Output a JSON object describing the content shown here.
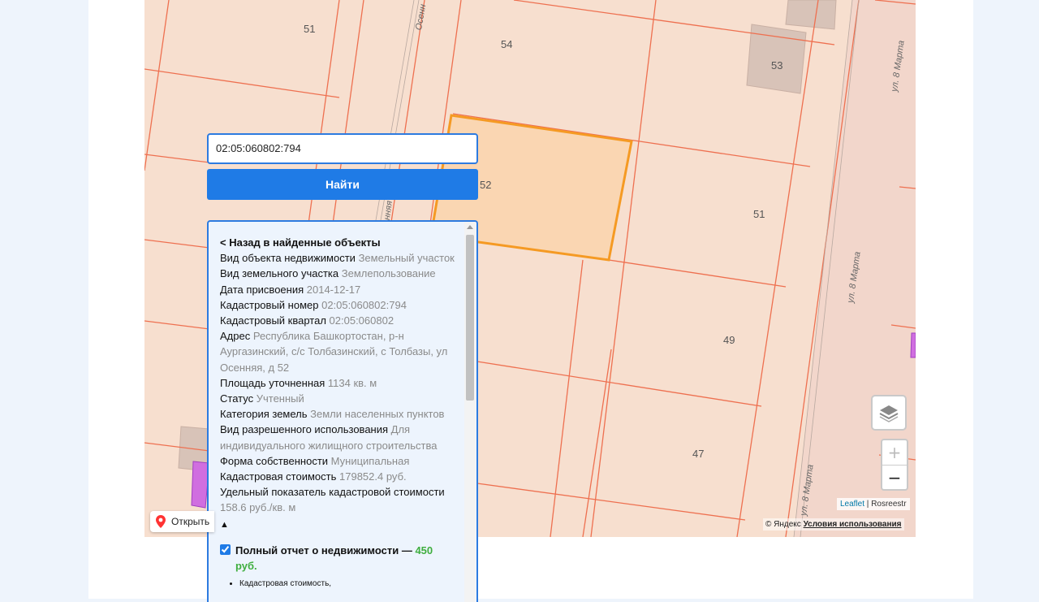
{
  "search": {
    "value": "02:05:060802:794"
  },
  "find_button": {
    "label": "Найти"
  },
  "map": {
    "plot_numbers": [
      "51",
      "54",
      "53",
      "52",
      "51",
      "49",
      "47"
    ],
    "streets": [
      "Осенн",
      "ул. 8 Марта",
      "ул. 8 Марта",
      "ул. 8 Марта",
      "енняя"
    ],
    "highlight_color": "#f59a23",
    "parcel_line_color": "#f07050"
  },
  "info": {
    "back_link": "< Назад в найденные объекты",
    "fields": [
      {
        "key": "Вид объекта недвижимости",
        "value": "Земельный участок"
      },
      {
        "key": "Вид земельного участка",
        "value": "Землепользование"
      },
      {
        "key": "Дата присвоения",
        "value": "2014-12-17"
      },
      {
        "key": "Кадастровый номер",
        "value": "02:05:060802:794"
      },
      {
        "key": "Кадастровый квартал",
        "value": "02:05:060802"
      },
      {
        "key": "Адрес",
        "value": "Республика Башкортостан, р-н Аургазинский, с/с Толбазинский, с Толбазы, ул Осенняя, д 52"
      },
      {
        "key": "Площадь уточненная",
        "value": "1134 кв. м"
      },
      {
        "key": "Статус",
        "value": "Учтенный"
      },
      {
        "key": "Категория земель",
        "value": "Земли населенных пунктов"
      },
      {
        "key": "Вид разрешенного использования",
        "value": "Для индивидуального жилищного строительства"
      },
      {
        "key": "Форма собственности",
        "value": "Муниципальная"
      },
      {
        "key": "Кадастровая стоимость",
        "value": "179852.4 руб."
      },
      {
        "key": "Удельный показатель кадастровой стоимости",
        "value": "158.6 руб./кв. м"
      }
    ],
    "collapse_arrow": "▲",
    "report": {
      "title": "Полный отчет о недвижимости — ",
      "price": "450 руб.",
      "checked": true,
      "items": [
        "Кадастровая стоимость,"
      ]
    }
  },
  "controls": {
    "layers_icon": "layers-icon",
    "zoom_in": "+",
    "zoom_out": "−"
  },
  "attribution": {
    "leaflet": "Leaflet",
    "separator": " | ",
    "source": "Rosreestr"
  },
  "yandex": {
    "copyright": "© Яндекс ",
    "terms": "Условия использования",
    "open_label": "Открыть"
  }
}
